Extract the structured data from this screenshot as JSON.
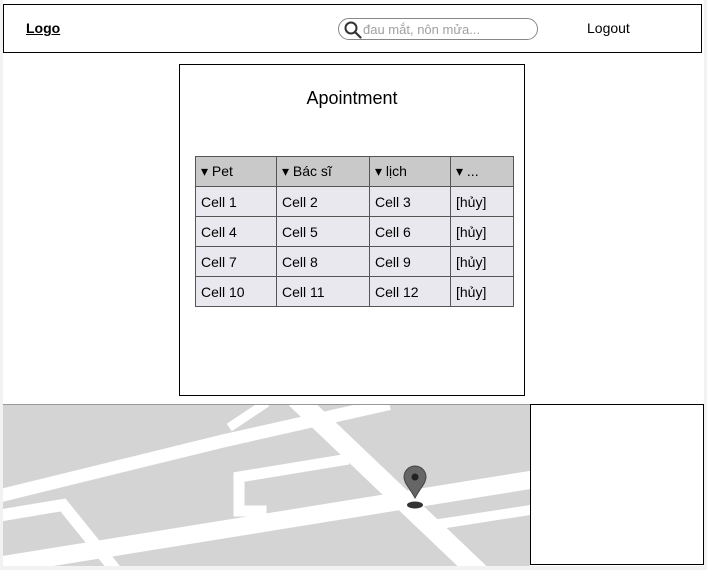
{
  "header": {
    "logo": "Logo",
    "search_placeholder": "đau mắt, nôn mửa...",
    "logout": "Logout"
  },
  "panel": {
    "title": "Apointment",
    "columns": [
      "▾ Pet",
      "▾ Bác sĩ",
      "▾ lịch",
      "▾ ..."
    ],
    "rows": [
      [
        "Cell 1",
        "Cell 2",
        "Cell 3",
        "[hủy]"
      ],
      [
        "Cell 4",
        "Cell 5",
        "Cell 6",
        "[hủy]"
      ],
      [
        "Cell 7",
        "Cell 8",
        "Cell 9",
        "[hủy]"
      ],
      [
        "Cell 10",
        "Cell 11",
        "Cell 12",
        "[hủy]"
      ]
    ]
  },
  "icons": {
    "search": "search-icon",
    "map_pin": "map-pin-icon"
  }
}
